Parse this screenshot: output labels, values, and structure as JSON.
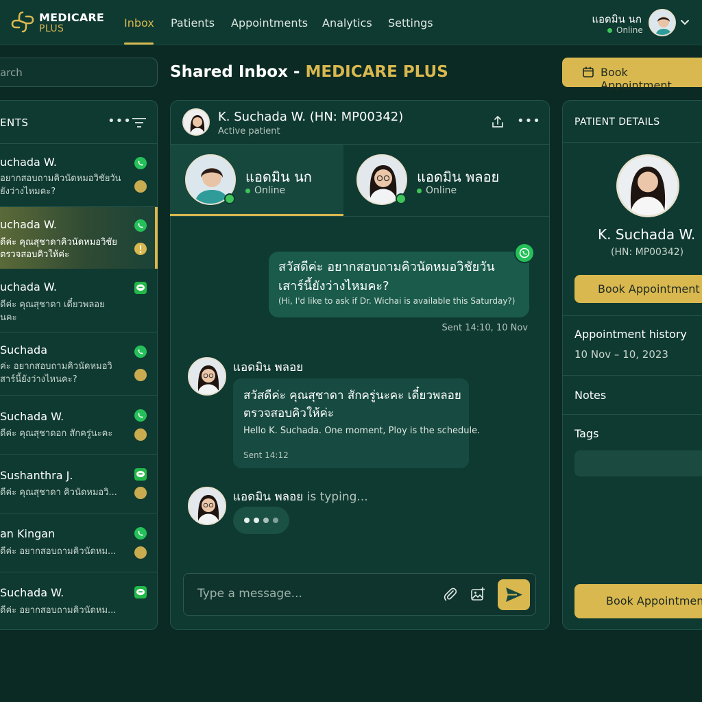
{
  "brand": {
    "name_line1": "MEDICARE",
    "name_line2": "PLUS"
  },
  "nav": {
    "inbox": "Inbox",
    "patients": "Patients",
    "appointments": "Appointments",
    "analytics": "Analytics",
    "settings": "Settings"
  },
  "user": {
    "name": "แอดมิน นก",
    "status": "Online"
  },
  "search": {
    "placeholder_visible": "arch"
  },
  "page": {
    "title_prefix": "Shared Inbox - ",
    "title_brand": "MEDICARE PLUS"
  },
  "top_button": {
    "label": "Book Appointment"
  },
  "patient_list": {
    "title": "ENTS",
    "items": [
      {
        "name": "uchada W.",
        "msg1": "อยากสอบถามคิวนัดหมอวิชัยวัน",
        "msg2": "ยังว่างไหมคะ?",
        "channel": "whatsapp",
        "indicator": "dot"
      },
      {
        "name": "uchada W.",
        "msg1": "ดีค่ะ คุณสุชาดาคิวนัดหมอวิชัย",
        "msg2": "ตรวจสอบคิวให้ค่ะ",
        "channel": "whatsapp",
        "indicator": "alert"
      },
      {
        "name": "uchada W.",
        "msg1": "ดีค่ะ คุณสุชาดา เดี๋ยวพลอย",
        "msg2": "นคะ",
        "channel": "line",
        "indicator": "none"
      },
      {
        "name": "Suchada",
        "msg1": "ค่ะ อยากสอบถามคิวนัดหมอวิ",
        "msg2": "สาร์นี้ยังว่างไหนคะ?",
        "channel": "whatsapp",
        "indicator": "dot"
      },
      {
        "name": "Suchada W.",
        "msg1": "ดีค่ะ คุณสุชาดอก สักครู่นะคะ",
        "msg2": "",
        "channel": "whatsapp",
        "indicator": "dot"
      },
      {
        "name": "Sushanthra J.",
        "msg1": "ดีค่ะ คุณสุชาดา คิวนัดหมอวิ...",
        "msg2": "",
        "channel": "line",
        "indicator": "dot"
      },
      {
        "name": "an Kingan",
        "msg1": "ดีค่ะ อยากสอบถามคิวนัดหม...",
        "msg2": "",
        "channel": "whatsapp",
        "indicator": "dot"
      },
      {
        "name": "Suchada W.",
        "msg1": "ดีค่ะ อยากสอบถามคิวนัดหม...",
        "msg2": "",
        "channel": "line",
        "indicator": "none"
      }
    ]
  },
  "chat": {
    "patient_name": "K. Suchada W. (HN: MP00342)",
    "patient_status": "Active patient",
    "agents": [
      {
        "name": "แอดมิน นก",
        "status": "Online"
      },
      {
        "name": "แอดมิน พลอย",
        "status": "Online"
      }
    ],
    "outgoing": {
      "thai_line1": "สวัสดีค่ะ อยากสอบถามคิวนัดหมอวิชัยวัน",
      "thai_line2": "เสาร์นี้ยังว่างไหมคะ?",
      "english": "(Hi, I'd like to ask if Dr. Wichai is available this Saturday?)",
      "time": "Sent 14:10, 10 Nov"
    },
    "incoming": {
      "sender": "แอดมิน พลอย",
      "thai_line1": "สวัสดีค่ะ คุณสุชาดา สักครู่นะคะ เดี๋ยวพลอย",
      "thai_line2": "ตรวจสอบคิวให้ค่ะ",
      "english": "Hello K. Suchada. One moment, Ploy is the schedule.",
      "time": "Sent 14:12"
    },
    "typing": {
      "name": "แอดมิน พลอย",
      "suffix": " is typing..."
    },
    "composer_placeholder": "Type a message..."
  },
  "details": {
    "title": "PATIENT DETAILS",
    "name": "K. Suchada W.",
    "hn": "(HN: MP00342)",
    "book_label": "Book Appointment",
    "history_label": "Appointment history",
    "history_value": "10 Nov – 10, 2023",
    "notes_label": "Notes",
    "tags_label": "Tags",
    "book_label_bottom": "Book Appointment"
  },
  "colors": {
    "background": "#0b2a24",
    "panel": "#0f3a31",
    "accent_gold": "#d9b84f",
    "online_green": "#3fc45a",
    "whatsapp_green": "#25c05a",
    "line_green": "#22b84a"
  }
}
